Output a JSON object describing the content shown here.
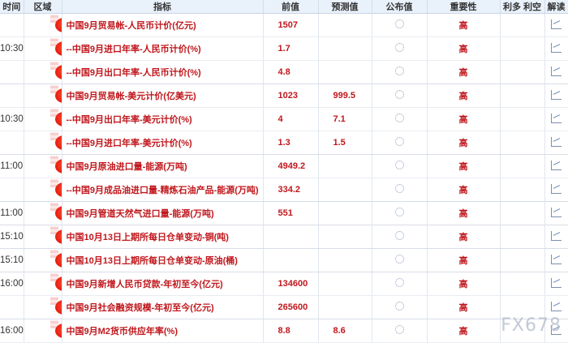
{
  "headers": {
    "time": "时间",
    "region": "区域",
    "indicator": "指标",
    "previous": "前值",
    "forecast": "预测值",
    "actual": "公布值",
    "importance": "重要性",
    "impact": "利多 利空",
    "analysis": "解读"
  },
  "rows": [
    {
      "time": "",
      "indicator": "中国9月贸易帐-人民币计价(亿元)",
      "previous": "1507",
      "forecast": "",
      "importance": "高"
    },
    {
      "time": "10:30",
      "indicator": "--中国9月进口年率-人民币计价(%)",
      "previous": "1.7",
      "forecast": "",
      "importance": "高"
    },
    {
      "time": "",
      "indicator": "--中国9月出口年率-人民币计价(%)",
      "previous": "4.8",
      "forecast": "",
      "importance": "高"
    },
    {
      "time": "",
      "indicator": "中国9月贸易帐-美元计价(亿美元)",
      "previous": "1023",
      "forecast": "999.5",
      "importance": "高"
    },
    {
      "time": "10:30",
      "indicator": "--中国9月出口年率-美元计价(%)",
      "previous": "4",
      "forecast": "7.1",
      "importance": "高"
    },
    {
      "time": "",
      "indicator": "--中国9月进口年率-美元计价(%)",
      "previous": "1.3",
      "forecast": "1.5",
      "importance": "高"
    },
    {
      "time": "11:00",
      "indicator": "中国9月原油进口量-能源(万吨)",
      "previous": "4949.2",
      "forecast": "",
      "importance": "高"
    },
    {
      "time": "",
      "indicator": "--中国9月成品油进口量-精炼石油产品-能源(万吨)",
      "previous": "334.2",
      "forecast": "",
      "importance": "高"
    },
    {
      "time": "11:00",
      "indicator": "中国9月管道天然气进口量-能源(万吨)",
      "previous": "551",
      "forecast": "",
      "importance": "高"
    },
    {
      "time": "15:10",
      "indicator": "中国10月13日上期所每日仓单变动-铜(吨)",
      "previous": "",
      "forecast": "",
      "importance": "高"
    },
    {
      "time": "15:10",
      "indicator": "中国10月13日上期所每日仓单变动-原油(桶)",
      "previous": "",
      "forecast": "",
      "importance": "高"
    },
    {
      "time": "16:00",
      "indicator": "中国9月新增人民币贷款-年初至今(亿元)",
      "previous": "134600",
      "forecast": "",
      "importance": "高"
    },
    {
      "time": "",
      "indicator": "中国9月社会融资规模-年初至今(亿元)",
      "previous": "265600",
      "forecast": "",
      "importance": "高"
    },
    {
      "time": "16:00",
      "indicator": "中国9月M2货币供应年率(%)",
      "previous": "8.8",
      "forecast": "8.6",
      "importance": "高"
    }
  ],
  "watermark": "FX678"
}
